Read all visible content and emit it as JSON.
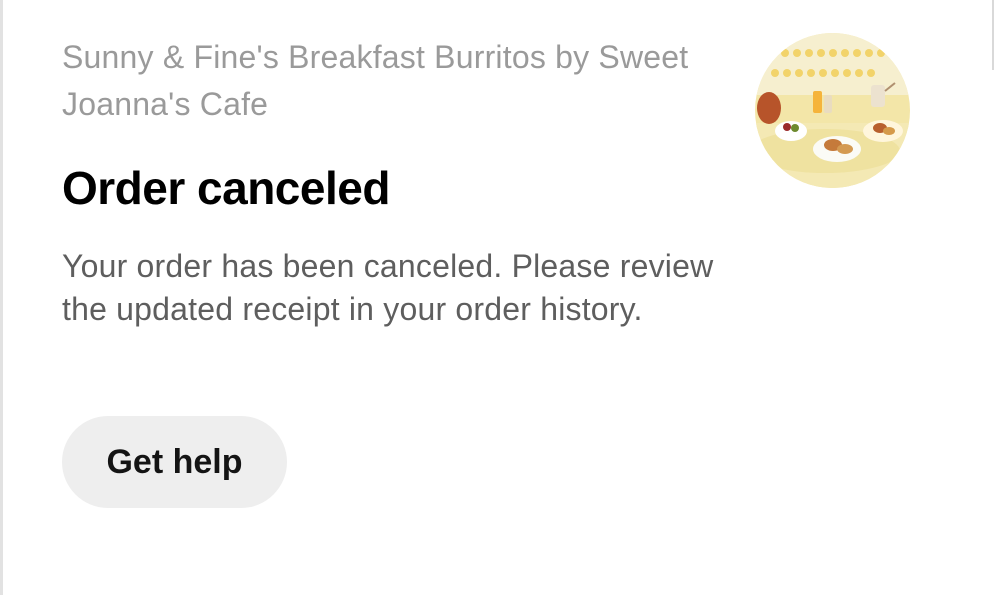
{
  "order": {
    "restaurant_name": "Sunny & Fine's Breakfast Burritos by Sweet Joanna's Cafe",
    "status_title": "Order canceled",
    "status_message": "Your order has been canceled. Please review the updated receipt in your order history.",
    "help_button_label": "Get help",
    "thumbnail_icon": "restaurant-food-photo"
  },
  "colors": {
    "title": "#000000",
    "restaurant": "#9a9a9a",
    "message": "#5e5e5e",
    "button_bg": "#eeeeee",
    "button_text": "#141414"
  }
}
